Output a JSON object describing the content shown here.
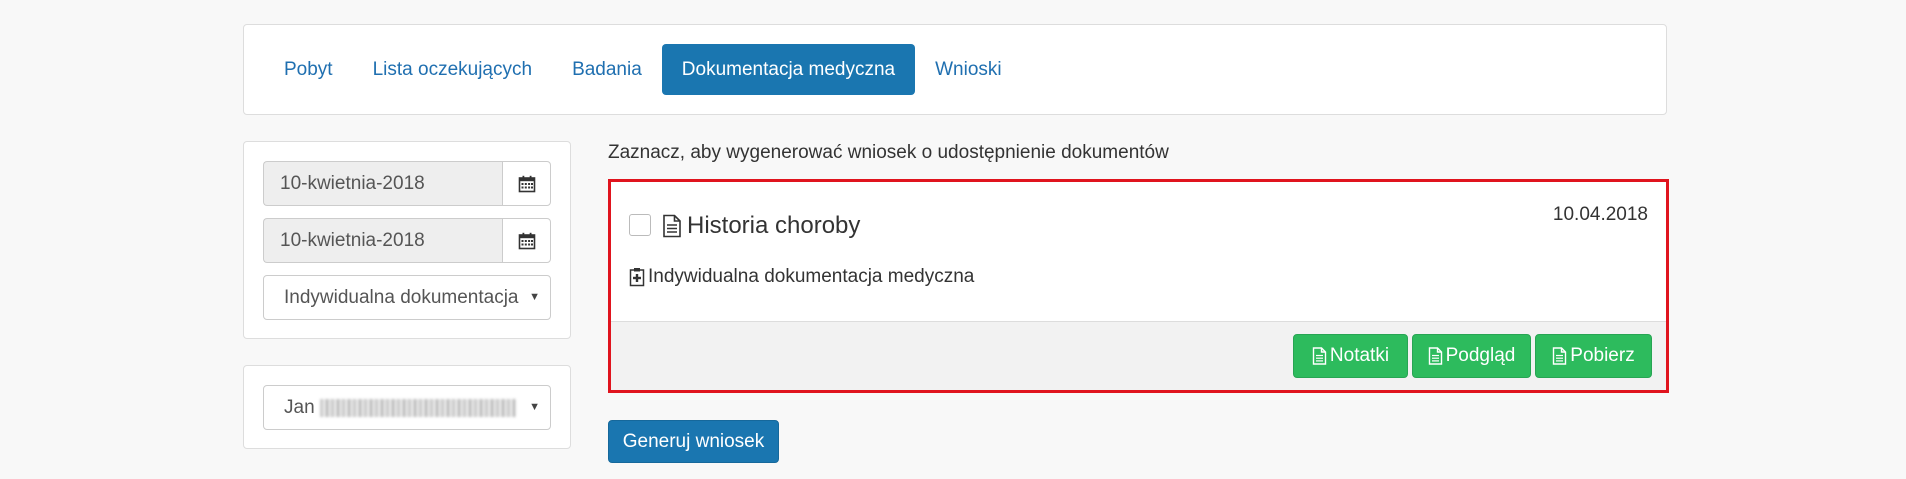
{
  "tabs": [
    {
      "label": "Pobyt",
      "active": false
    },
    {
      "label": "Lista oczekujących",
      "active": false
    },
    {
      "label": "Badania",
      "active": false
    },
    {
      "label": "Dokumentacja medyczna",
      "active": true
    },
    {
      "label": "Wnioski",
      "active": false
    }
  ],
  "filters": {
    "date_from": "10-kwietnia-2018",
    "date_to": "10-kwietnia-2018",
    "doc_type_select": "Indywidualna dokumentacja",
    "patient_select_prefix": "Jan"
  },
  "main": {
    "instruction": "Zaznacz, aby wygenerować wniosek o udostępnienie dokumentów",
    "document": {
      "title": "Historia choroby",
      "date": "10.04.2018",
      "type": "Indywidualna dokumentacja medyczna",
      "buttons": {
        "notes": "Notatki",
        "preview": "Podgląd",
        "download": "Pobierz"
      }
    },
    "generate_button": "Generuj wniosek"
  },
  "icons": {
    "calendar": "calendar-icon",
    "document": "file-text-icon",
    "clipboard": "clipboard-icon",
    "caret": "caret-down-icon"
  },
  "colors": {
    "primary": "#1a76b0",
    "success": "#2dbb5d",
    "highlight_border": "#e0141e"
  }
}
